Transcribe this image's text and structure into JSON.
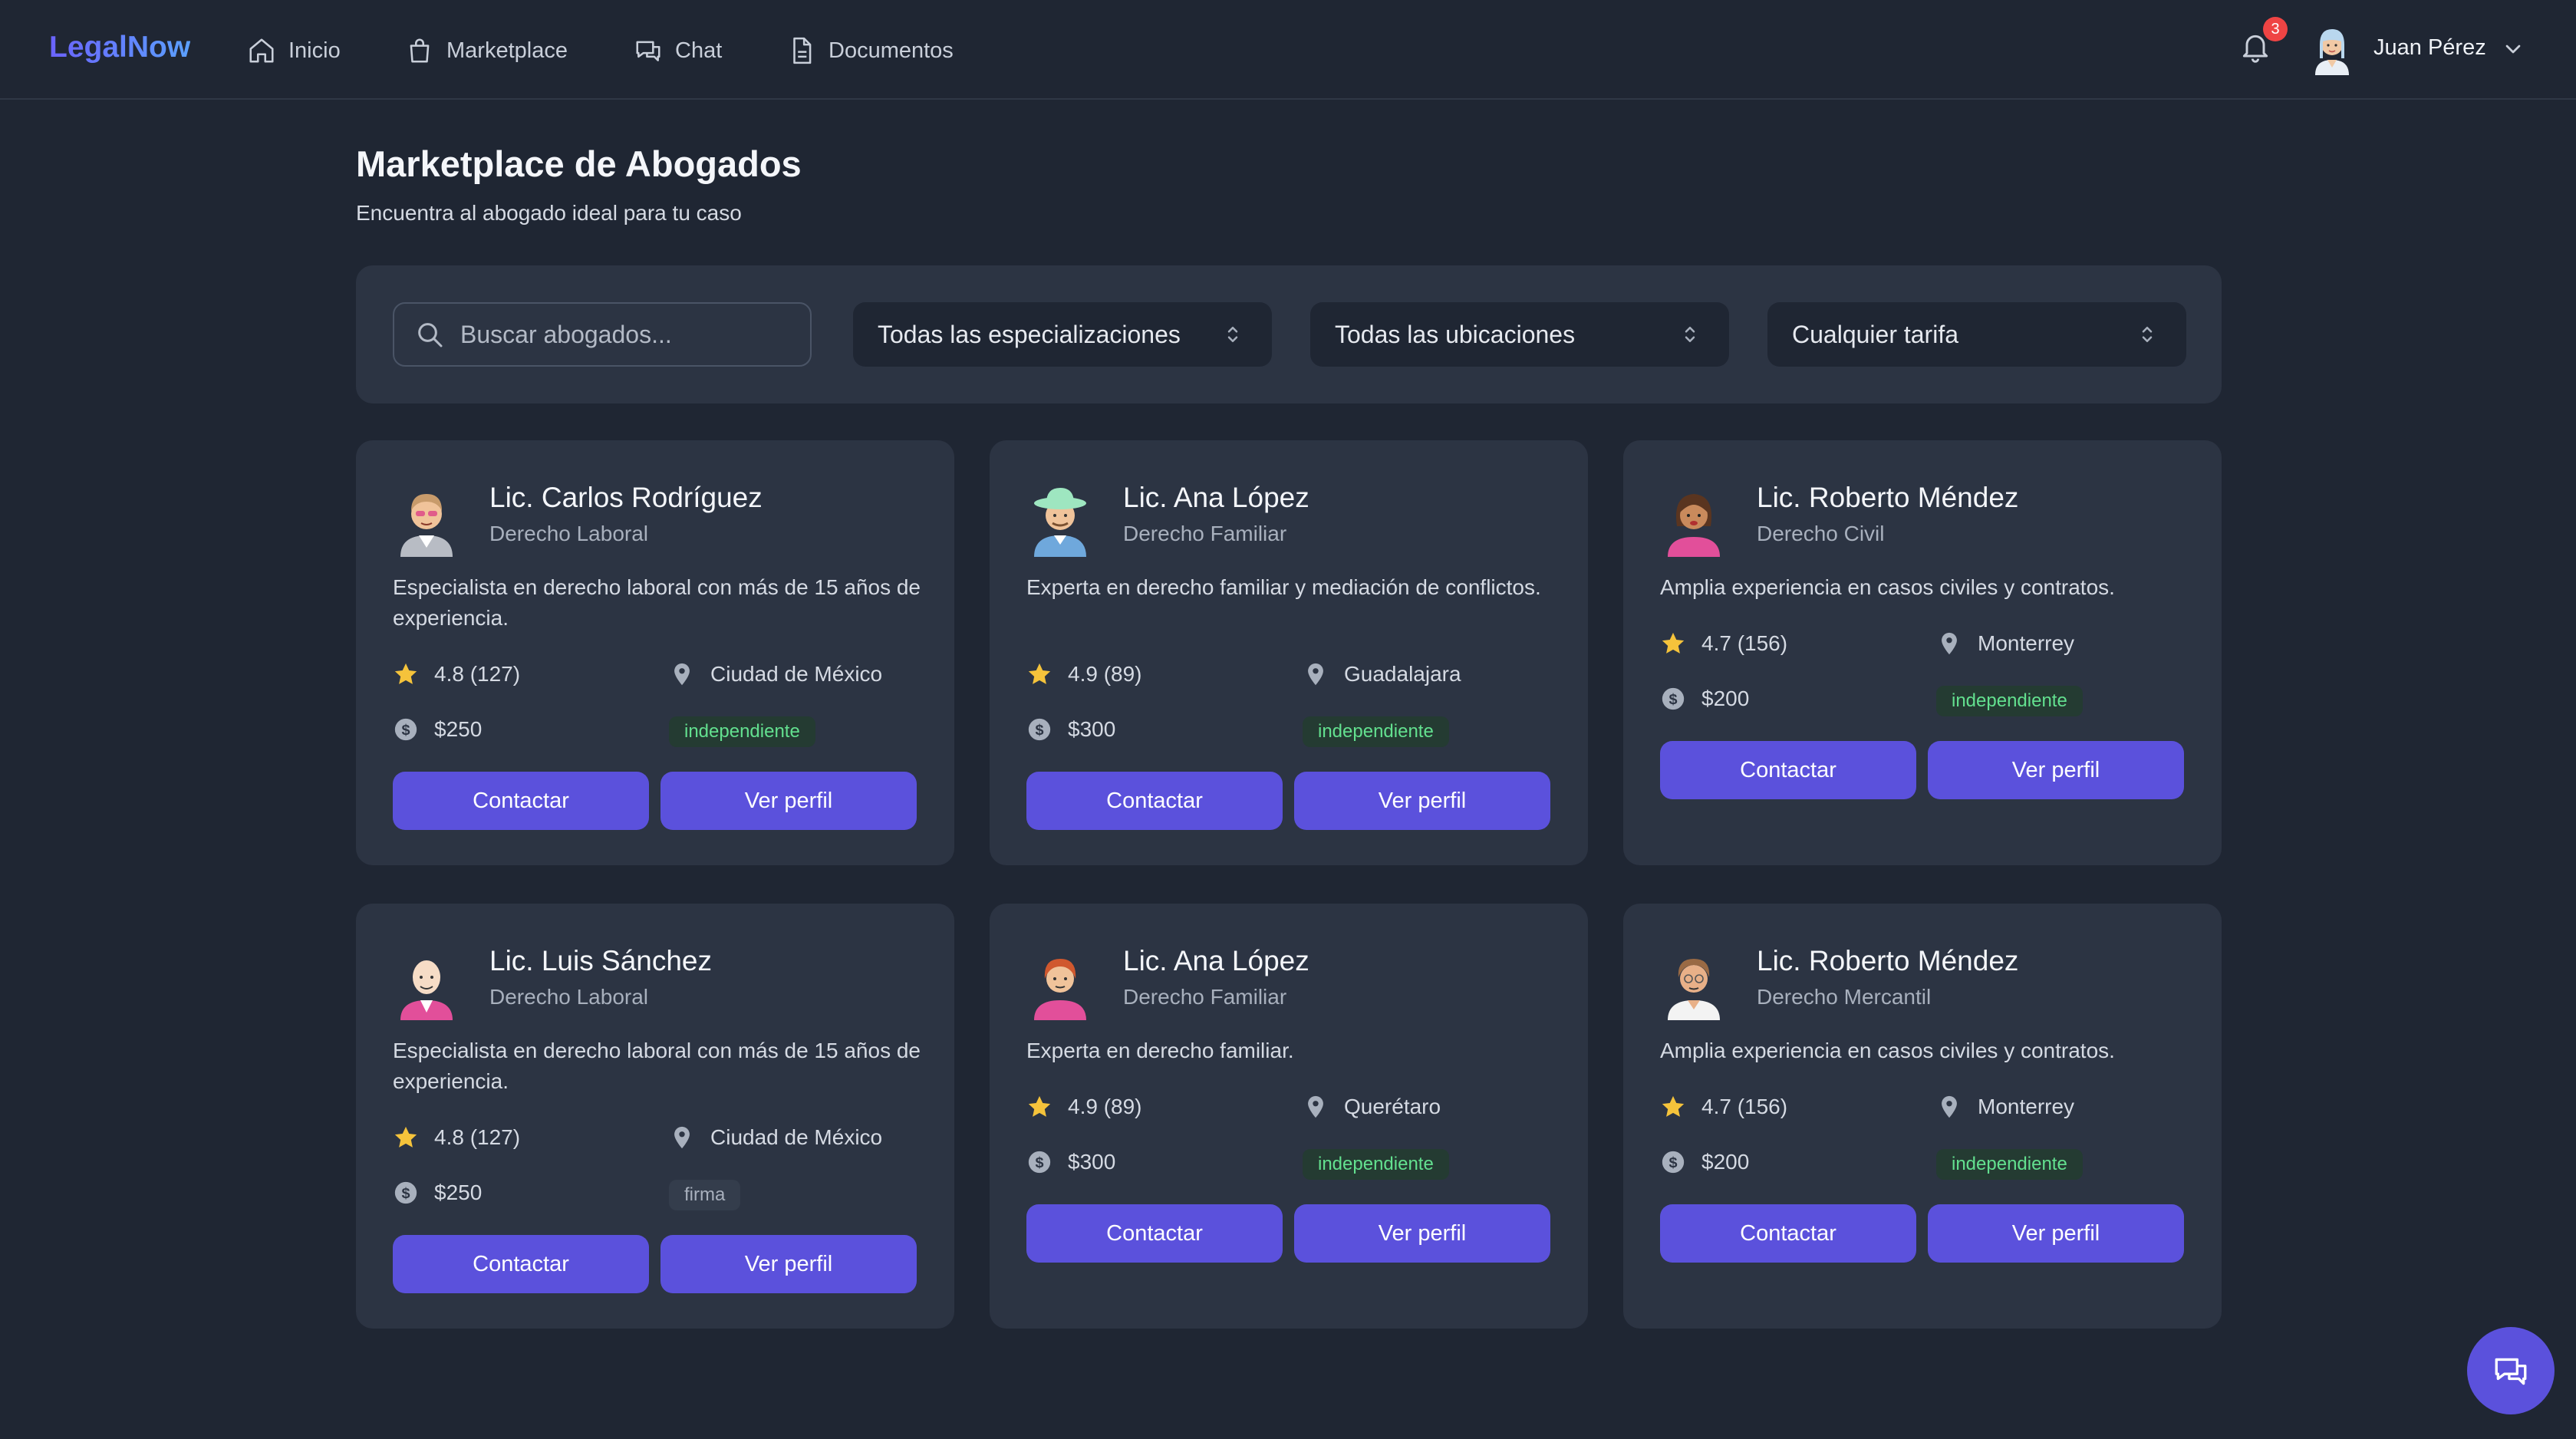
{
  "app": {
    "brand": "LegalNow"
  },
  "nav": {
    "items": [
      {
        "label": "Inicio",
        "icon": "home-icon"
      },
      {
        "label": "Marketplace",
        "icon": "shopping-bag-icon"
      },
      {
        "label": "Chat",
        "icon": "chat-icon"
      },
      {
        "label": "Documentos",
        "icon": "document-icon"
      }
    ],
    "notifications_count": "3",
    "user_name": "Juan Pérez"
  },
  "header": {
    "title": "Marketplace de Abogados",
    "subtitle": "Encuentra al abogado ideal para tu caso"
  },
  "filters": {
    "search_placeholder": "Buscar abogados...",
    "specialization": "Todas las especializaciones",
    "location": "Todas las ubicaciones",
    "rate": "Cualquier tarifa"
  },
  "lawyers": [
    {
      "name": "Lic. Carlos Rodríguez",
      "specialty": "Derecho Laboral",
      "description": "Especialista en derecho laboral con más de 15 años de experiencia.",
      "rating": "4.8 (127)",
      "location": "Ciudad de México",
      "rate": "$250",
      "type": "independiente",
      "contact": "Contactar",
      "profile": "Ver perfil"
    },
    {
      "name": "Lic. Ana López",
      "specialty": "Derecho Familiar",
      "description": "Experta en derecho familiar y mediación de conflictos.",
      "rating": "4.9 (89)",
      "location": "Guadalajara",
      "rate": "$300",
      "type": "independiente",
      "contact": "Contactar",
      "profile": "Ver perfil"
    },
    {
      "name": "Lic. Roberto Méndez",
      "specialty": "Derecho Civil",
      "description": "Amplia experiencia en casos civiles y contratos.",
      "rating": "4.7 (156)",
      "location": "Monterrey",
      "rate": "$200",
      "type": "independiente",
      "contact": "Contactar",
      "profile": "Ver perfil"
    },
    {
      "name": "Lic. Luis Sánchez",
      "specialty": "Derecho Laboral",
      "description": "Especialista en derecho laboral con más de 15 años de experiencia.",
      "rating": "4.8 (127)",
      "location": "Ciudad de México",
      "rate": "$250",
      "type": "firma",
      "contact": "Contactar",
      "profile": "Ver perfil"
    },
    {
      "name": "Lic. Ana López",
      "specialty": "Derecho Familiar",
      "description": "Experta en derecho familiar.",
      "rating": "4.9 (89)",
      "location": "Querétaro",
      "rate": "$300",
      "type": "independiente",
      "contact": "Contactar",
      "profile": "Ver perfil"
    },
    {
      "name": "Lic. Roberto Méndez",
      "specialty": "Derecho Mercantil",
      "description": "Amplia experiencia en casos civiles y contratos.",
      "rating": "4.7 (156)",
      "location": "Monterrey",
      "rate": "$200",
      "type": "independiente",
      "contact": "Contactar",
      "profile": "Ver perfil"
    }
  ],
  "colors": {
    "background": "#1f2633",
    "card": "#2c3443",
    "accent": "#5b51dc",
    "star": "#f5c33b",
    "tag_independent": "#63e08f"
  }
}
